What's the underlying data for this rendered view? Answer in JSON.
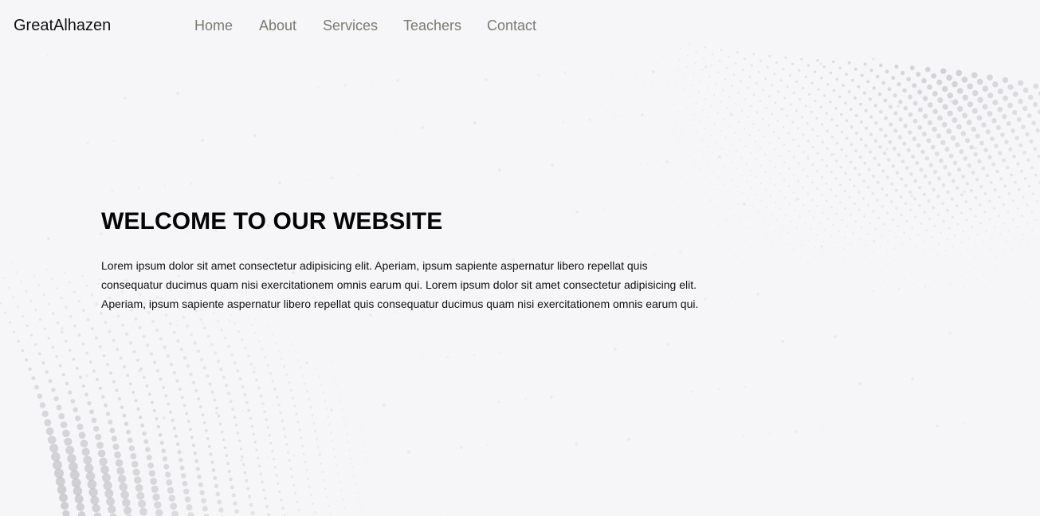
{
  "brand": {
    "name": "GreatAlhazen"
  },
  "nav": {
    "items": [
      {
        "label": "Home"
      },
      {
        "label": "About"
      },
      {
        "label": "Services"
      },
      {
        "label": "Teachers"
      },
      {
        "label": "Contact"
      }
    ]
  },
  "hero": {
    "title": "WELCOME TO OUR WEBSITE",
    "body": "Lorem ipsum dolor sit amet consectetur adipisicing elit. Aperiam, ipsum sapiente aspernatur libero repellat quis consequatur ducimus quam nisi exercitationem omnis earum qui. Lorem ipsum dolor sit amet consectetur adipisicing elit. Aperiam, ipsum sapiente aspernatur libero repellat quis consequatur ducimus quam nisi exercitationem omnis earum qui."
  },
  "colors": {
    "background": "#f6f6f8",
    "brand_text": "#111111",
    "nav_text": "#7a7a72",
    "pattern_dots": "#bfbfc4"
  }
}
